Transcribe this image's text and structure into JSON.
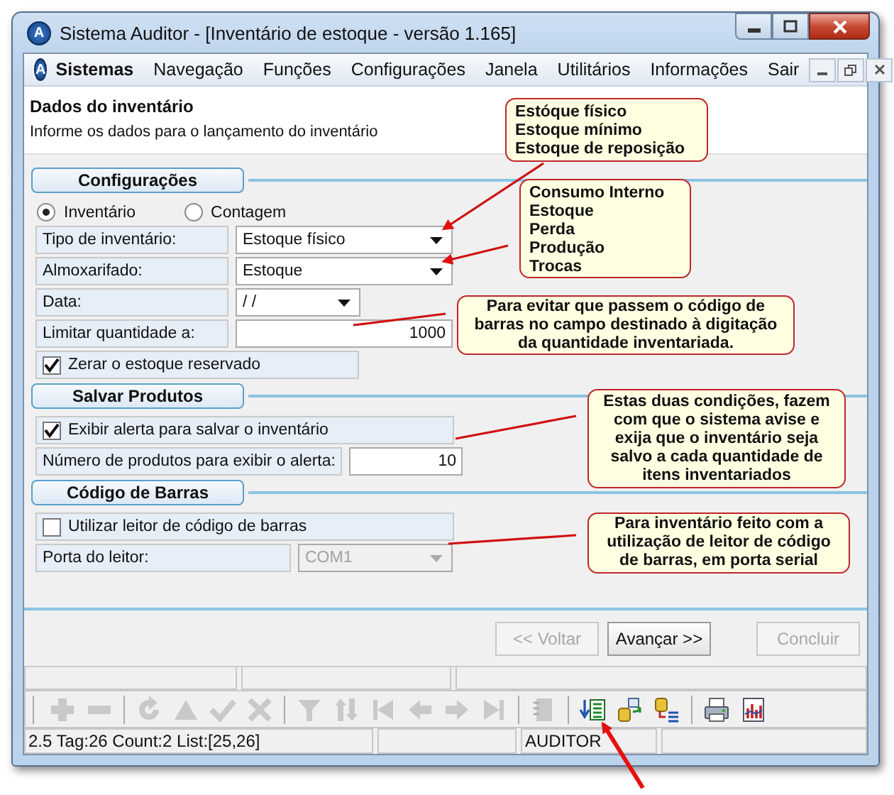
{
  "window": {
    "logo_letter": "A",
    "title": "Sistema Auditor - [Inventário de estoque - versão 1.165]"
  },
  "menu": {
    "logo_letter": "A",
    "items": [
      {
        "label": "Sistemas",
        "bold": true
      },
      {
        "label": "Navegação",
        "bold": false
      },
      {
        "label": "Funções",
        "bold": false
      },
      {
        "label": "Configurações",
        "bold": false
      },
      {
        "label": "Janela",
        "bold": false
      },
      {
        "label": "Utilitários",
        "bold": false
      },
      {
        "label": "Informações",
        "bold": false
      },
      {
        "label": "Sair",
        "bold": false
      }
    ]
  },
  "header": {
    "title": "Dados do inventário",
    "subtitle": "Informe os dados para o lançamento do inventário"
  },
  "sections": [
    {
      "title": "Configurações",
      "radios": [
        {
          "label": "Inventário",
          "selected": true
        },
        {
          "label": "Contagem",
          "selected": false
        }
      ],
      "rows": [
        {
          "kind": "select",
          "label": "Tipo de inventário:",
          "value": "Estoque físico",
          "disabled": false
        },
        {
          "kind": "select",
          "label": "Almoxarifado:",
          "value": "Estoque",
          "disabled": false
        },
        {
          "kind": "date",
          "label": "Data:",
          "value": " /  /",
          "disabled": false
        },
        {
          "kind": "number",
          "label": "Limitar quantidade a:",
          "value": "1000",
          "disabled": false
        },
        {
          "kind": "checkbox",
          "label": "Zerar o estoque reservado",
          "checked": true
        }
      ]
    },
    {
      "title": "Salvar Produtos",
      "rows": [
        {
          "kind": "checkbox",
          "label": "Exibir alerta para salvar o inventário",
          "checked": true
        },
        {
          "kind": "number",
          "label": "Número de produtos para exibir o alerta:",
          "value": "10",
          "disabled": false
        }
      ]
    },
    {
      "title": "Código de Barras",
      "rows": [
        {
          "kind": "checkbox",
          "label": "Utilizar leitor de código de barras",
          "checked": false
        },
        {
          "kind": "select",
          "label": "Porta do leitor:",
          "value": "COM1",
          "disabled": true
        }
      ]
    }
  ],
  "buttons": [
    {
      "label": "<< Voltar",
      "disabled": true
    },
    {
      "label": "Avançar >>",
      "disabled": false
    },
    {
      "label": "Concluir",
      "disabled": true
    }
  ],
  "toolbar": [
    {
      "kind": "plus",
      "disabled": true
    },
    {
      "kind": "minus",
      "disabled": true
    },
    {
      "kind": "separator"
    },
    {
      "kind": "refresh",
      "disabled": true
    },
    {
      "kind": "up",
      "disabled": true
    },
    {
      "kind": "check",
      "disabled": true
    },
    {
      "kind": "cross",
      "disabled": true
    },
    {
      "kind": "separator"
    },
    {
      "kind": "funnel",
      "disabled": true
    },
    {
      "kind": "sort",
      "disabled": true
    },
    {
      "kind": "first",
      "disabled": true
    },
    {
      "kind": "prev",
      "disabled": true
    },
    {
      "kind": "next",
      "disabled": true
    },
    {
      "kind": "last",
      "disabled": true
    },
    {
      "kind": "separator"
    },
    {
      "kind": "notebook",
      "disabled": true
    },
    {
      "kind": "separator"
    },
    {
      "kind": "list-import",
      "disabled": false
    },
    {
      "kind": "db-transfer",
      "disabled": false
    },
    {
      "kind": "db-list",
      "disabled": false
    },
    {
      "kind": "separator"
    },
    {
      "kind": "printer",
      "disabled": false
    },
    {
      "kind": "chart",
      "disabled": false
    }
  ],
  "status_bar": {
    "info": "2.5 Tag:26 Count:2 List:[25,26]",
    "user": "AUDITOR"
  },
  "callouts": [
    {
      "kind": "list",
      "text": "Estóque físico\nEstoque mínimo\nEstoque de reposição"
    },
    {
      "kind": "list",
      "text": "Consumo Interno\nEstoque\nPerda\nProdução\nTrocas"
    },
    {
      "kind": "note",
      "text": "Para evitar que passem o código de\nbarras no campo destinado à digitação\nda quantidade inventariada."
    },
    {
      "kind": "note",
      "text": "Estas duas condições, fazem\ncom que o sistema avise e\nexija que o inventário seja\nsalvo a cada quantidade de\nitens inventariados"
    },
    {
      "kind": "note",
      "text": "Para inventário feito com a\nutilização de leitor de código\nde barras, em porta serial"
    }
  ]
}
